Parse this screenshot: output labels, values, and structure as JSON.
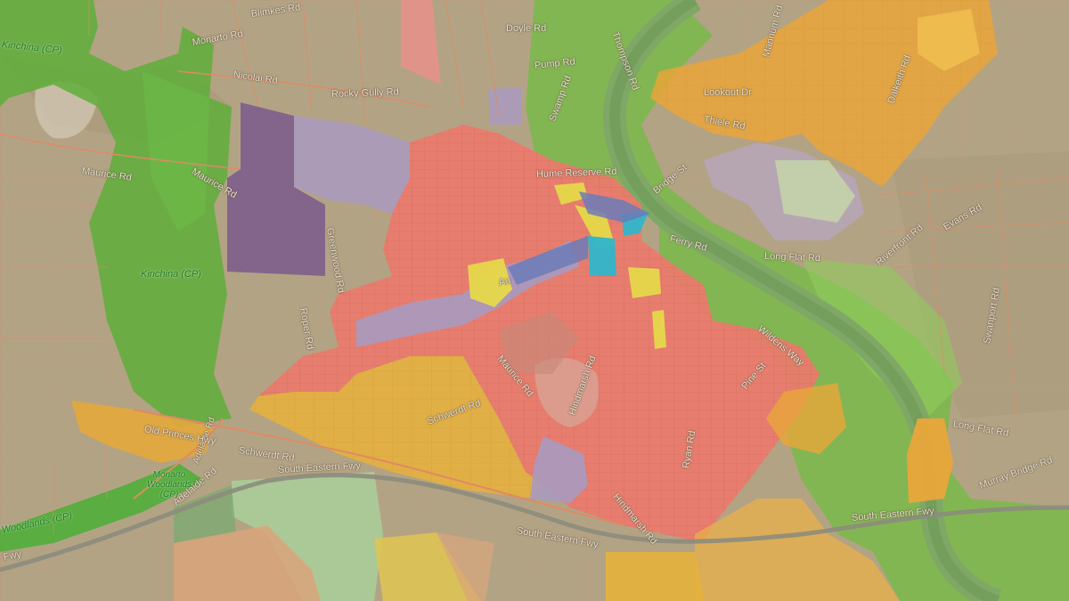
{
  "map": {
    "zone_colors": {
      "rural": "#b3a385",
      "conservation": "#5fae3a",
      "river_corridor": "#7cb84e",
      "residential": "#ec7a6c",
      "living": "#e9a63a",
      "industry": "#7a5a8c",
      "light_industry": "#a99ac0",
      "township_activity": "#e6d84a",
      "commercial": "#2fb6c9",
      "river": "#79a65a",
      "road": "#e08a63",
      "farm_green": "#a9d09a",
      "farm_tan": "#d9a57a"
    },
    "labels": {
      "road_blimkes": "Blimkes Rd",
      "road_monarto": "Monarto Rd",
      "road_nicolai": "Nicolai Rd",
      "road_rosevear": "Rocky Gully Rd",
      "road_maurice_w": "Maurice Rd",
      "road_maurice_e": "Maurice Rd",
      "road_doyle": "Doyle Rd",
      "road_pump": "Pump Rd",
      "road_thompson": "Thompson Rd",
      "road_swamp": "Swamp Rd",
      "road_lookout": "Lookout Dr",
      "road_thiele": "Thiele Rd",
      "road_mannum": "Mannum Rd",
      "road_dalkeith": "Dalkeith Rd",
      "road_hume": "Hume Reserve Rd",
      "road_bridge": "Bridge St",
      "road_ferry": "Ferry Rd",
      "road_adelaide": "Adelaide Rd",
      "road_old_princes": "Old Princes Hwy",
      "road_schwerdt_w": "Schwerdt Rd",
      "road_schwerdt_e": "Schwerdt Rd",
      "road_sef_w": "South Eastern Fwy",
      "road_sef_c": "South Eastern Fwy",
      "road_sef_e": "South Eastern Fwy",
      "road_fwy": "Fwy",
      "road_swanport": "Swanport Rd",
      "road_long_flat": "Long Flat Rd",
      "road_long_flat_e": "Long Flat Rd",
      "road_evans": "Evans Rd",
      "road_riverfront": "Riverfront Rd",
      "road_wildens": "Wildens Way",
      "road_maurice_c": "Maurice Rd",
      "road_hindmarsh": "Hindmarsh Rd",
      "road_pine": "Pine St",
      "road_ryan": "Ryan Rd",
      "road_murray_bridge_rd": "Murray Bridge Rd",
      "road_auto": "Au",
      "road_greenwood": "Greenwood Rd",
      "road_roper": "Roper Rd",
      "park_kinchina_n": "Kinchina (CP)",
      "park_kinchina_s": "Kinchina (CP)",
      "park_monarto": "Monarto Woodlands (CP)",
      "park_woodlands": "Woodlands (CP)"
    }
  }
}
